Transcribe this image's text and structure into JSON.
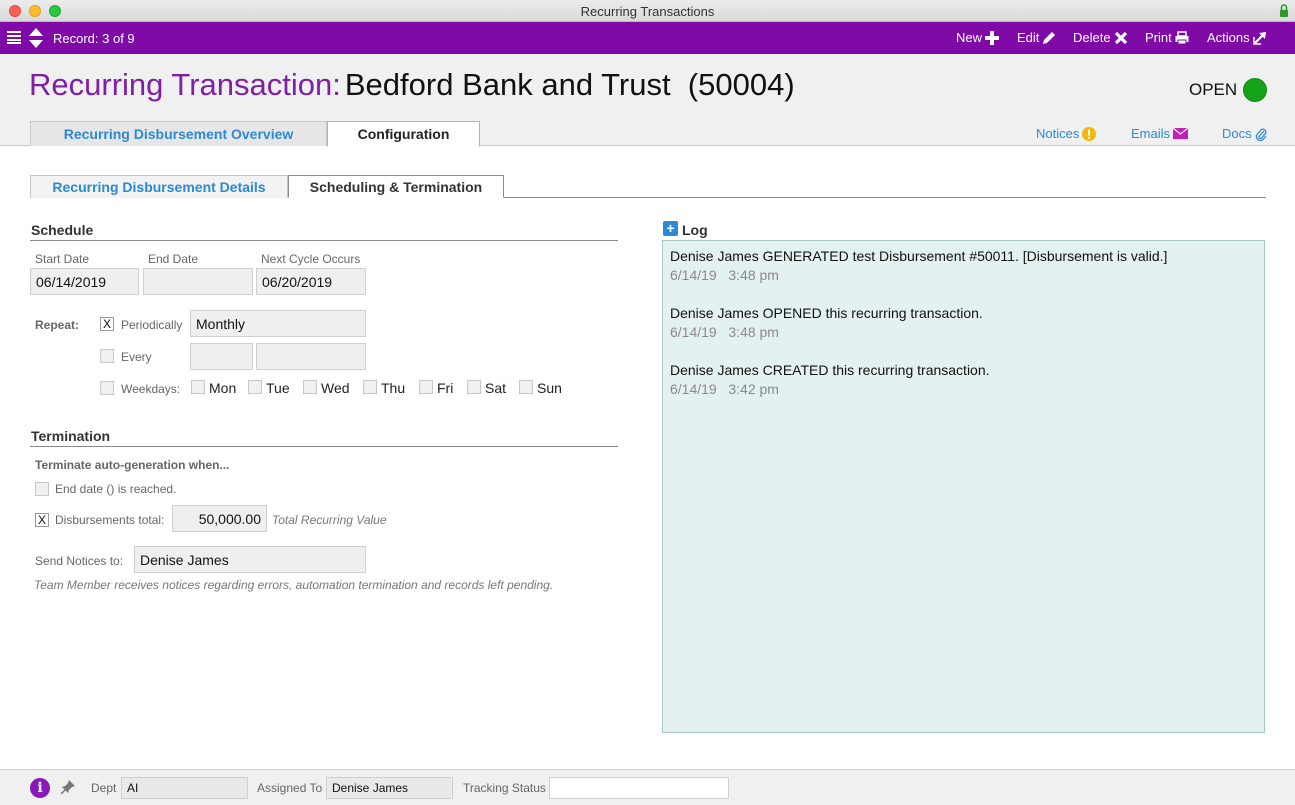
{
  "window": {
    "title": "Recurring Transactions"
  },
  "toolbar": {
    "record": "Record: 3 of 9",
    "new_label": "New",
    "edit_label": "Edit",
    "delete_label": "Delete",
    "print_label": "Print",
    "actions_label": "Actions"
  },
  "header": {
    "title_prefix": "Recurring Transaction:",
    "title_name": "Bedford Bank and Trust  (50004)",
    "status": "OPEN",
    "status_color": "#16a318",
    "tabs": [
      {
        "label": "Recurring Disbursement Overview"
      },
      {
        "label": "Configuration"
      }
    ],
    "links": {
      "notices": "Notices",
      "emails": "Emails",
      "docs": "Docs"
    }
  },
  "subtabs": [
    {
      "label": "Recurring Disbursement Details"
    },
    {
      "label": "Scheduling & Termination"
    }
  ],
  "schedule": {
    "title": "Schedule",
    "start_date_label": "Start Date",
    "start_date": "06/14/2019",
    "end_date_label": "End Date",
    "end_date": "",
    "next_cycle_label": "Next Cycle Occurs",
    "next_cycle": "06/20/2019",
    "repeat_label": "Repeat:",
    "periodically_label": "Periodically",
    "periodically_checked": "X",
    "periodically_value": "Monthly",
    "every_label": "Every",
    "weekdays_label": "Weekdays:",
    "days": [
      "Mon",
      "Tue",
      "Wed",
      "Thu",
      "Fri",
      "Sat",
      "Sun"
    ]
  },
  "termination": {
    "title": "Termination",
    "subtitle": "Terminate auto-generation when...",
    "end_date_reached_label": "End date () is reached.",
    "disb_total_label": "Disbursements total:",
    "disb_total_checked": "X",
    "disb_total_value": "50,000.00",
    "disb_total_note": "Total Recurring Value",
    "send_notices_label": "Send Notices to:",
    "send_notices_value": "Denise James",
    "team_note": "Team Member receives notices regarding errors, automation termination and records left pending."
  },
  "log": {
    "title": "Log",
    "entries": [
      {
        "message": "Denise James GENERATED test Disbursement #50011. [Disbursement is valid.]",
        "time": "6/14/19   3:48 pm"
      },
      {
        "message": "Denise James OPENED this recurring transaction.",
        "time": "6/14/19   3:48 pm"
      },
      {
        "message": "Denise James CREATED this recurring transaction.",
        "time": "6/14/19   3:42 pm"
      }
    ]
  },
  "footer": {
    "dept_label": "Dept",
    "dept_value": "AI",
    "assigned_label": "Assigned To",
    "assigned_value": "Denise James",
    "tracking_label": "Tracking Status",
    "tracking_value": ""
  },
  "icons": {
    "menu": "menu-icon",
    "record_nav": "up-down-arrows-icon",
    "new": "plus-icon",
    "edit": "pencil-icon",
    "delete": "x-icon",
    "print": "printer-icon",
    "actions": "arrow-out-icon",
    "notices": "warning-icon",
    "emails": "envelope-icon",
    "docs": "paperclip-icon",
    "info": "info-icon",
    "pin": "pin-icon",
    "lock": "lock-icon"
  },
  "colors": {
    "toolbar": "#7f0aa8",
    "title_prefix": "#7e1fa6",
    "link": "#2a8ad4",
    "notice_icon": "#f5b50a",
    "email_icon": "#c21fb8",
    "log_bg": "#e3f1f0"
  }
}
